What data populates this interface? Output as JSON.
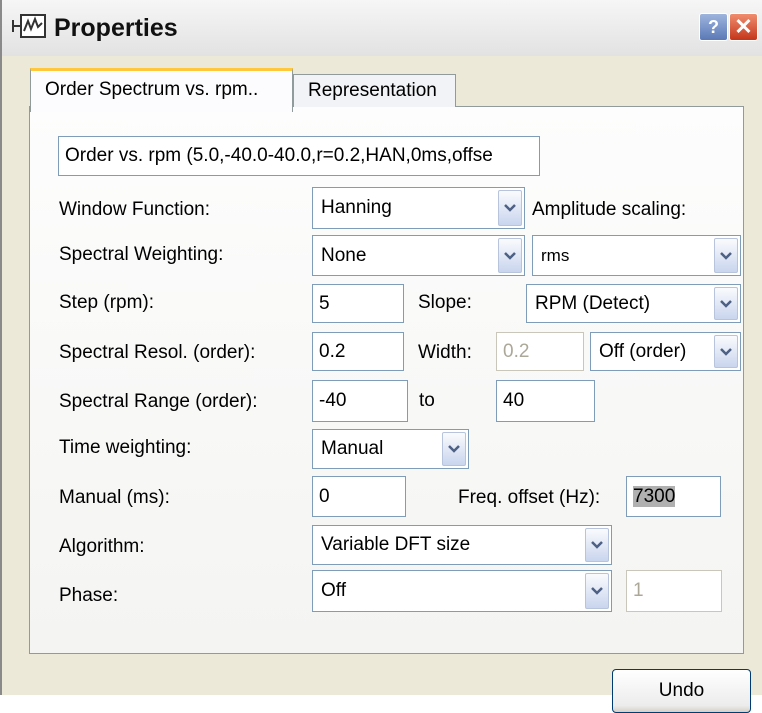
{
  "window": {
    "title": "Properties",
    "help_glyph": "?",
    "close_glyph": "✕"
  },
  "tabs": [
    {
      "label": "Order Spectrum vs. rpm..",
      "active": true
    },
    {
      "label": "Representation",
      "active": false
    }
  ],
  "summary": "Order vs. rpm (5.0,-40.0-40.0,r=0.2,HAN,0ms,offse",
  "form": {
    "window_function": {
      "label": "Window Function:",
      "value": "Hanning"
    },
    "amplitude_scaling": {
      "label": "Amplitude scaling:",
      "value": "rms"
    },
    "spectral_weighting": {
      "label": "Spectral Weighting:",
      "value": "None"
    },
    "step": {
      "label": "Step (rpm):",
      "value": "5"
    },
    "slope": {
      "label": "Slope:",
      "value": "RPM (Detect)"
    },
    "spectral_resol": {
      "label": "Spectral Resol. (order):",
      "value": "0.2"
    },
    "width": {
      "label": "Width:",
      "value": "0.2",
      "mode": "Off (order)"
    },
    "spectral_range": {
      "label": "Spectral Range (order):",
      "from": "-40",
      "to_label": "to",
      "to": "40"
    },
    "time_weighting": {
      "label": "Time weighting:",
      "value": "Manual"
    },
    "manual_ms": {
      "label": "Manual (ms):",
      "value": "0"
    },
    "freq_offset": {
      "label": "Freq. offset (Hz):",
      "value": "7300"
    },
    "algorithm": {
      "label": "Algorithm:",
      "value": "Variable DFT size"
    },
    "phase": {
      "label": "Phase:",
      "value": "Off",
      "extra_value": "1"
    }
  },
  "buttons": {
    "undo": "Undo"
  },
  "colors": {
    "tab_highlight": "#ffc83c",
    "field_border": "#7f9db9",
    "close_red": "#c4361b",
    "help_blue": "#5b79b7"
  }
}
